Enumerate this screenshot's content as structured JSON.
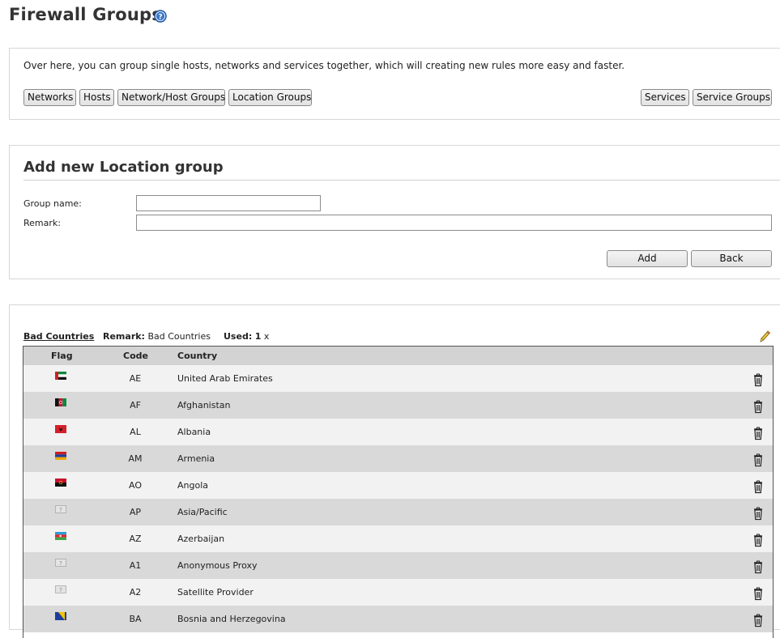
{
  "page": {
    "title": "Firewall Groups"
  },
  "intro": {
    "text": "Over here, you can group single hosts, networks and services together, which will creating new rules more easy and faster.",
    "buttons_left": [
      "Networks",
      "Hosts",
      "Network/Host Groups",
      "Location Groups"
    ],
    "buttons_right": [
      "Services",
      "Service Groups"
    ]
  },
  "add_form": {
    "title": "Add new Location group",
    "group_name_label": "Group name:",
    "group_name_value": "",
    "remark_label": "Remark:",
    "remark_value": "",
    "add_label": "Add",
    "back_label": "Back"
  },
  "group": {
    "name": "Bad Countries",
    "remark_label": "Remark:",
    "remark": "Bad Countries",
    "used_label": "Used:",
    "used_count": "1",
    "used_suffix": "x",
    "columns": [
      "Flag",
      "Code",
      "Country"
    ],
    "rows": [
      {
        "code": "AE",
        "country": "United Arab Emirates",
        "flag": "ae"
      },
      {
        "code": "AF",
        "country": "Afghanistan",
        "flag": "af"
      },
      {
        "code": "AL",
        "country": "Albania",
        "flag": "al"
      },
      {
        "code": "AM",
        "country": "Armenia",
        "flag": "am"
      },
      {
        "code": "AO",
        "country": "Angola",
        "flag": "ao"
      },
      {
        "code": "AP",
        "country": "Asia/Pacific",
        "flag": "unknown"
      },
      {
        "code": "AZ",
        "country": "Azerbaijan",
        "flag": "az"
      },
      {
        "code": "A1",
        "country": "Anonymous Proxy",
        "flag": "unknown"
      },
      {
        "code": "A2",
        "country": "Satellite Provider",
        "flag": "unknown"
      },
      {
        "code": "BA",
        "country": "Bosnia and Herzegovina",
        "flag": "ba"
      }
    ]
  },
  "icons": {
    "help": "help-icon",
    "edit": "pencil-icon",
    "delete": "trash-icon"
  },
  "colors": {
    "help_blue": "#3a78c9",
    "row_odd": "#f2f2f2",
    "row_even": "#d9d9d9",
    "header": "#d3d3d3"
  }
}
